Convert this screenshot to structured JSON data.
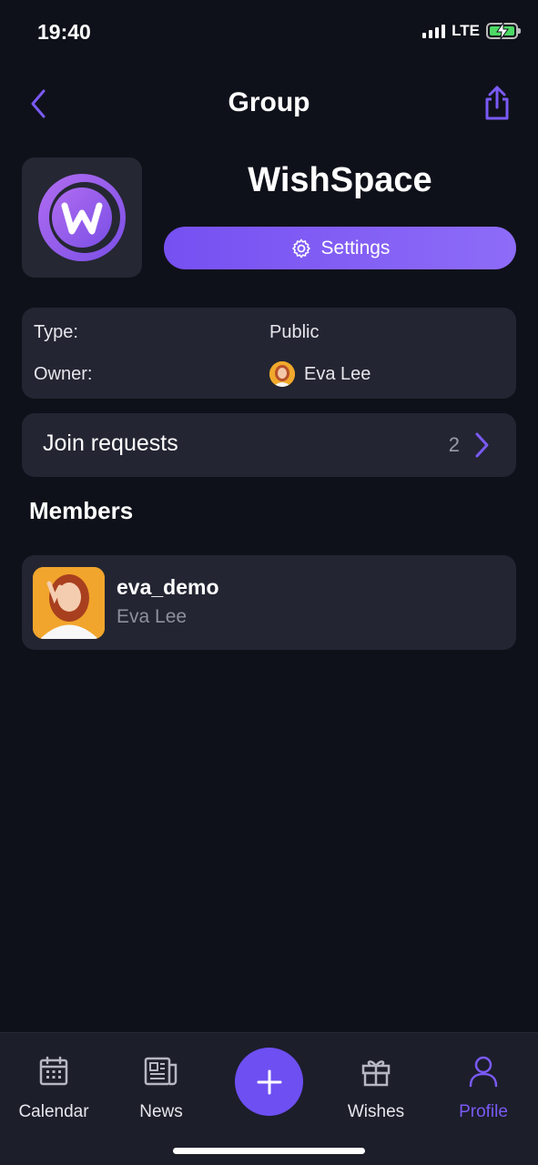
{
  "status_bar": {
    "time": "19:40",
    "network": "LTE"
  },
  "nav": {
    "title": "Group",
    "back_icon": "chevron-left-icon",
    "share_icon": "share-icon"
  },
  "group": {
    "name": "WishSpace",
    "logo_letter": "W",
    "settings_label": "Settings"
  },
  "info": {
    "type_label": "Type:",
    "type_value": "Public",
    "owner_label": "Owner:",
    "owner_value": "Eva Lee"
  },
  "join_requests": {
    "label": "Join requests",
    "count": "2"
  },
  "members": {
    "title": "Members",
    "items": [
      {
        "username": "eva_demo",
        "name": "Eva Lee"
      }
    ]
  },
  "tab_bar": {
    "tabs": [
      {
        "label": "Calendar",
        "icon": "calendar-icon"
      },
      {
        "label": "News",
        "icon": "newspaper-icon"
      },
      {
        "label": "Wishes",
        "icon": "gift-icon"
      },
      {
        "label": "Profile",
        "icon": "person-icon"
      }
    ],
    "active": "Profile",
    "fab_icon": "plus-icon"
  },
  "colors": {
    "background": "#0f111a",
    "card": "#232532",
    "accent": "#7650f1",
    "tab_bar": "#1c1e2a"
  }
}
